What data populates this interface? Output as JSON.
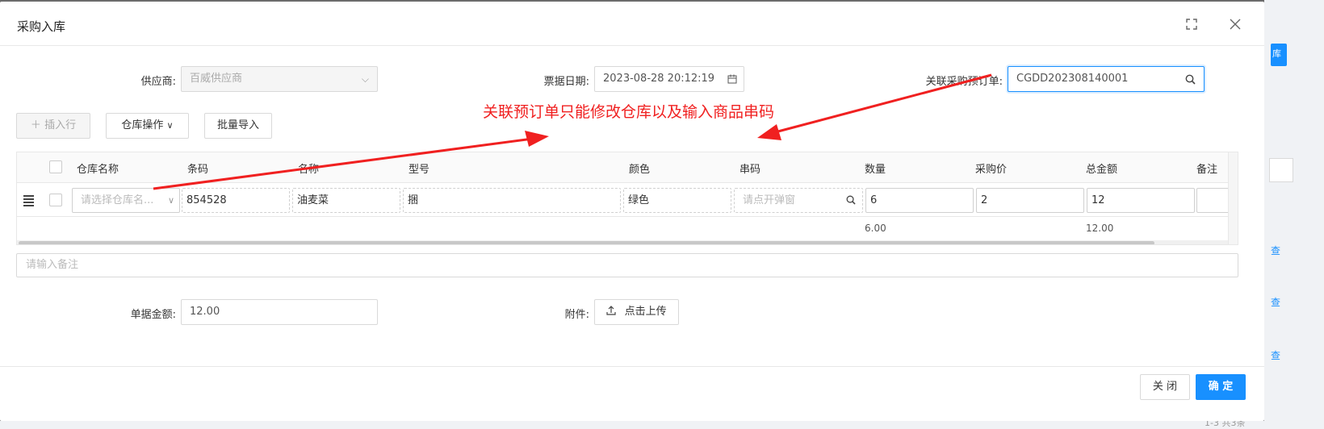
{
  "modal": {
    "title": "采购入库"
  },
  "form": {
    "supplier_label": "供应商:",
    "supplier_value": "百威供应商",
    "date_label": "票据日期:",
    "date_value": "2023-08-28 20:12:19",
    "order_label": "关联采购预订单:",
    "order_value": "CGDD202308140001"
  },
  "toolbar": {
    "insert_row": "插入行",
    "warehouse_ops": "仓库操作",
    "batch_import": "批量导入"
  },
  "annotation_text": "关联预订单只能修改仓库以及输入商品串码",
  "table": {
    "columns": [
      "仓库名称",
      "条码",
      "名称",
      "型号",
      "颜色",
      "串码",
      "数量",
      "采购价",
      "总金额",
      "备注"
    ],
    "row": {
      "warehouse_placeholder": "请选择仓库名...",
      "barcode": "854528",
      "name": "油麦菜",
      "model": "捆",
      "color": "绿色",
      "serial_placeholder": "请点开弹窗",
      "quantity": "6",
      "price": "2",
      "total": "12",
      "note": ""
    },
    "summary": {
      "quantity": "6.00",
      "total": "12.00"
    }
  },
  "remark_placeholder": "请输入备注",
  "bottom": {
    "amount_label": "单据金额:",
    "amount_value": "12.00",
    "attachment_label": "附件:",
    "upload_label": "点击上传"
  },
  "footer": {
    "close": "关 闭",
    "confirm": "确 定"
  },
  "background": {
    "pagination": "1-3 共3条"
  },
  "colors": {
    "primary": "#1890ff",
    "annotation": "#f02020"
  }
}
